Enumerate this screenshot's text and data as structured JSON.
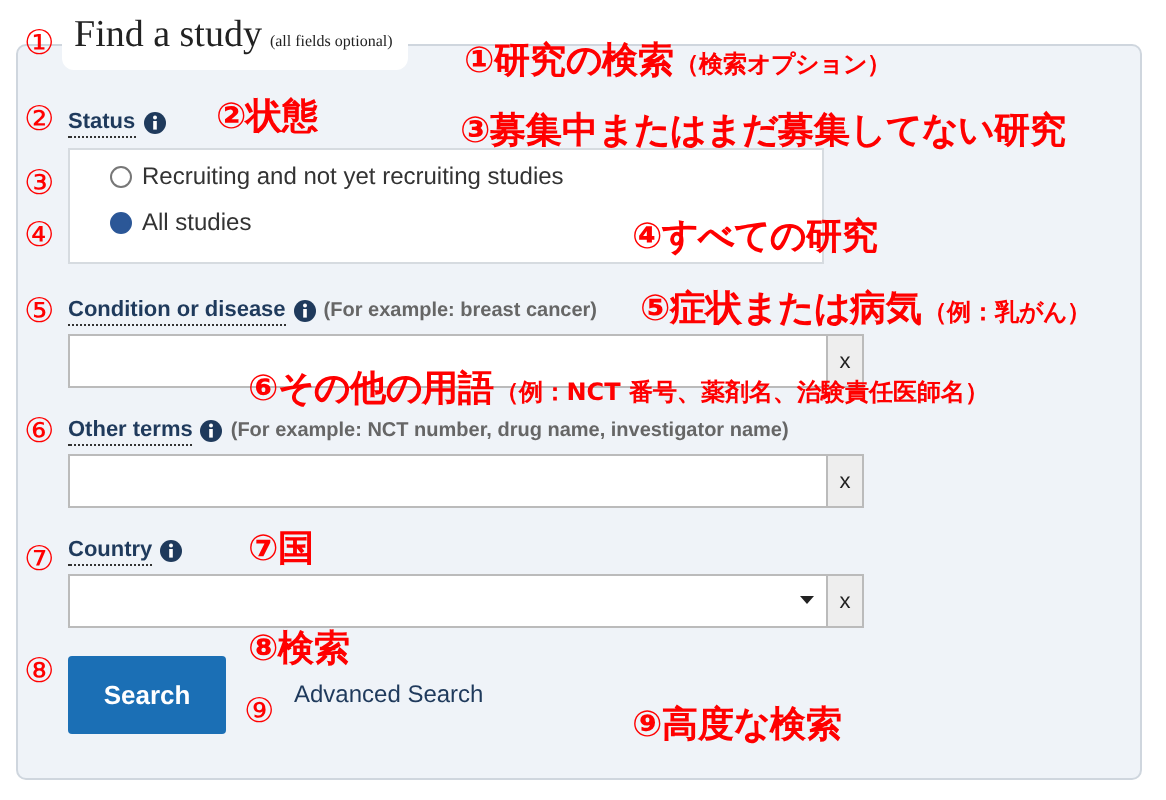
{
  "form": {
    "title": "Find a study",
    "title_note": "(all fields optional)",
    "status": {
      "label": "Status",
      "options": [
        {
          "label": "Recruiting and not yet recruiting studies",
          "selected": false
        },
        {
          "label": "All studies",
          "selected": true
        }
      ]
    },
    "fields": [
      {
        "kind": "text",
        "label": "Condition or disease",
        "hint": "(For example: breast cancer)",
        "clear": "x"
      },
      {
        "kind": "text",
        "label": "Other terms",
        "hint": "(For example: NCT number, drug name, investigator name)",
        "clear": "x"
      },
      {
        "kind": "select",
        "label": "Country",
        "clear": "x"
      }
    ],
    "search_button": "Search",
    "advanced_link": "Advanced Search"
  },
  "markers": [
    "①",
    "②",
    "③",
    "④",
    "⑤",
    "⑥",
    "⑦",
    "⑧",
    "⑨"
  ],
  "annotations": [
    {
      "text": "①研究の検索",
      "note": "（検索オプション）"
    },
    {
      "text": "②状態"
    },
    {
      "text": "③募集中またはまだ募集してない研究"
    },
    {
      "text": "④すべての研究"
    },
    {
      "text": "⑤症状または病気",
      "note": "（例：乳がん）"
    },
    {
      "text": "⑥その他の用語",
      "note": "（例：NCT 番号、薬剤名、治験責任医師名）"
    },
    {
      "text": "⑦国"
    },
    {
      "text": "⑧検索"
    },
    {
      "text": "⑨高度な検索"
    }
  ]
}
